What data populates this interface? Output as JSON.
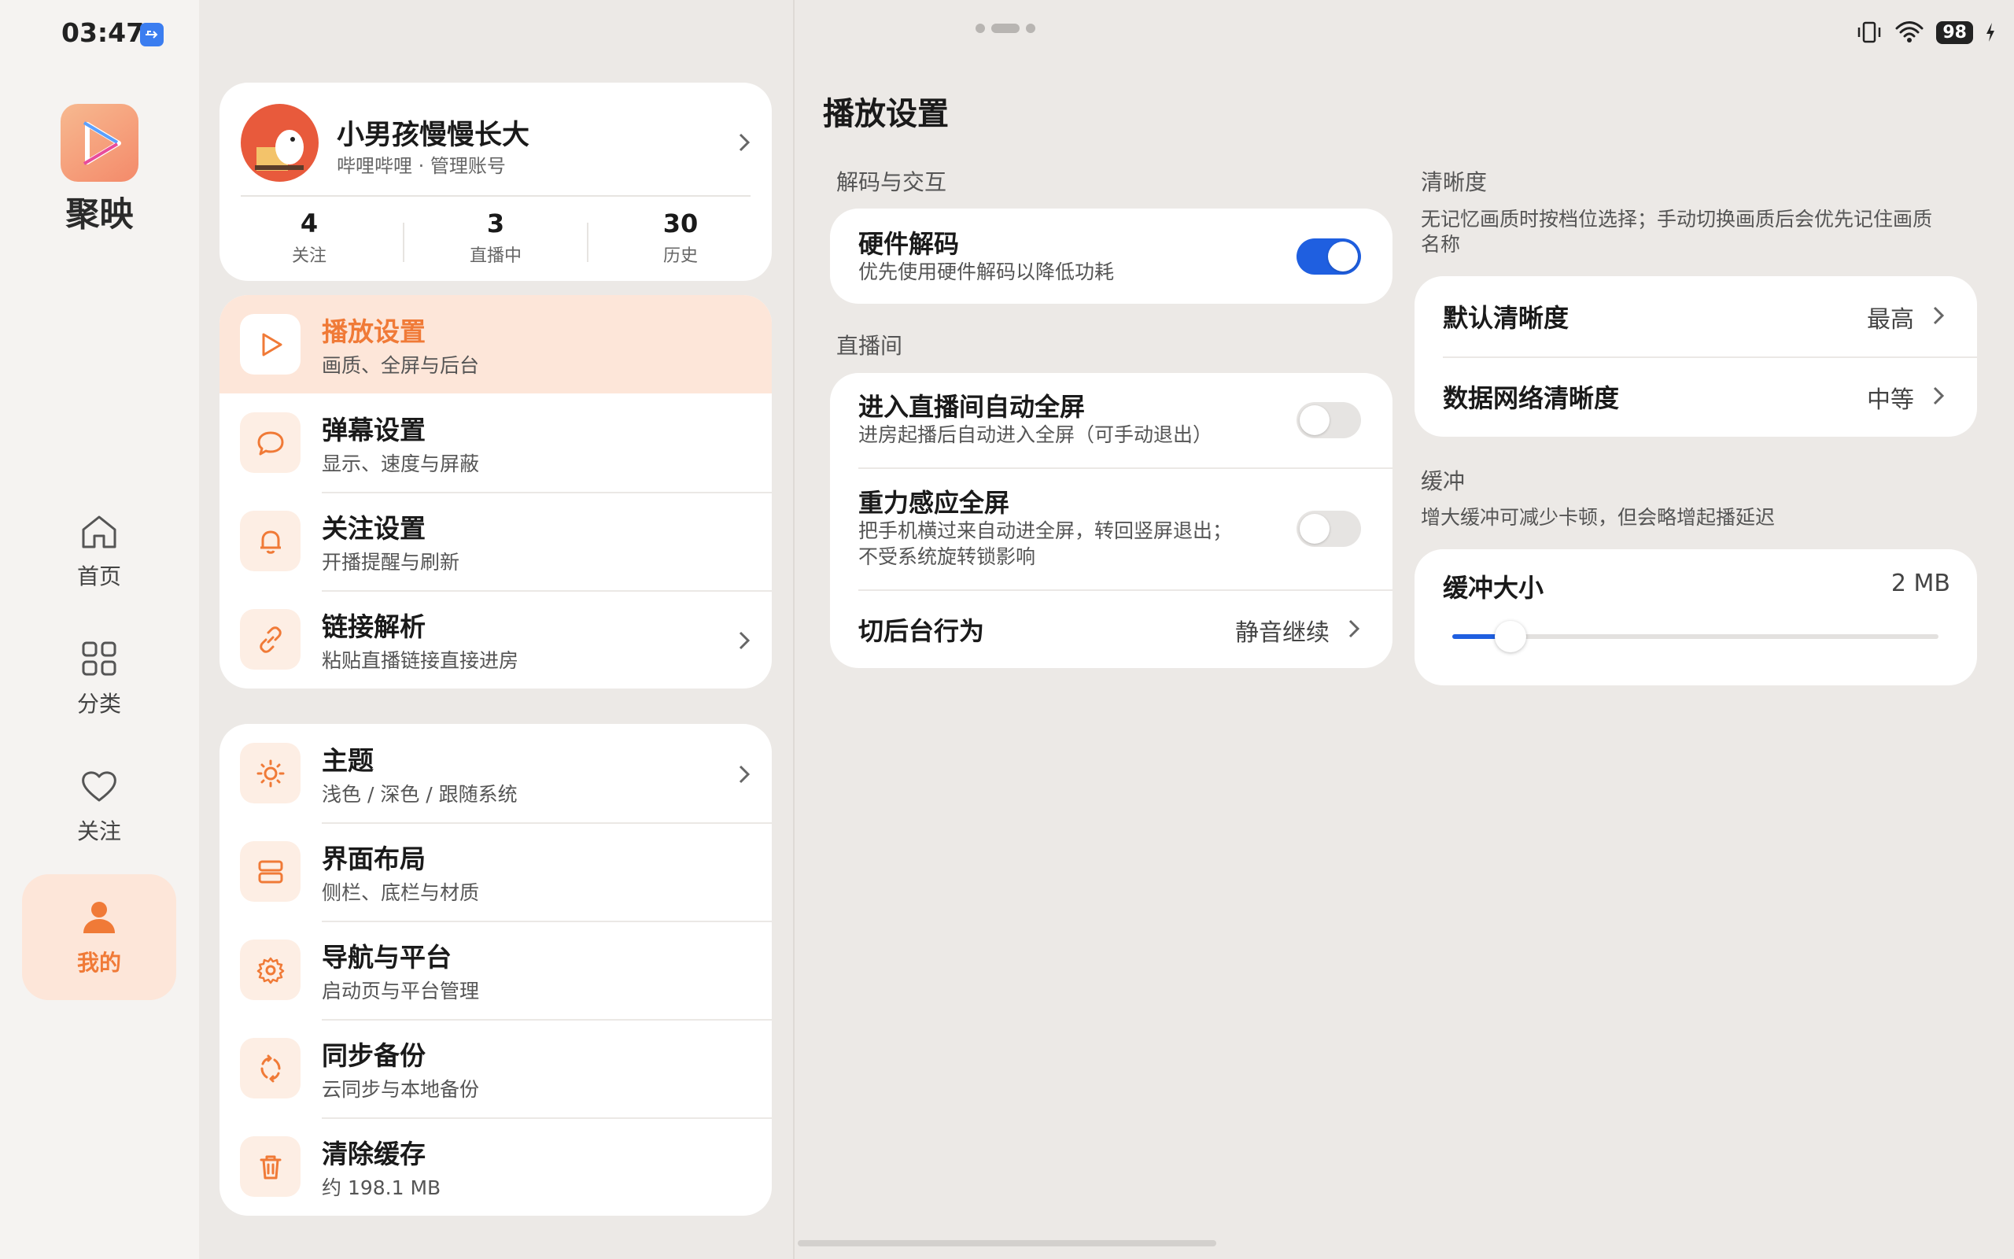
{
  "status_bar": {
    "time": "03:47",
    "battery": "98"
  },
  "app": {
    "name": "聚映"
  },
  "nav": [
    {
      "label": "首页",
      "icon": "home-icon"
    },
    {
      "label": "分类",
      "icon": "grid-icon"
    },
    {
      "label": "关注",
      "icon": "heart-icon"
    },
    {
      "label": "我的",
      "icon": "person-icon",
      "active": true
    }
  ],
  "profile": {
    "name": "小男孩慢慢长大",
    "subtitle": "哔哩哔哩 · 管理账号",
    "stats": [
      {
        "num": "4",
        "label": "关注"
      },
      {
        "num": "3",
        "label": "直播中"
      },
      {
        "num": "30",
        "label": "历史"
      }
    ]
  },
  "menu_group1": [
    {
      "title": "播放设置",
      "sub": "画质、全屏与后台",
      "icon": "play-icon",
      "active": true
    },
    {
      "title": "弹幕设置",
      "sub": "显示、速度与屏蔽",
      "icon": "chat-bubble-icon"
    },
    {
      "title": "关注设置",
      "sub": "开播提醒与刷新",
      "icon": "bell-icon"
    },
    {
      "title": "链接解析",
      "sub": "粘贴直播链接直接进房",
      "icon": "link-icon",
      "chevron": true
    }
  ],
  "menu_group2": [
    {
      "title": "主题",
      "sub": "浅色 / 深色 / 跟随系统",
      "icon": "sun-icon",
      "chevron": true
    },
    {
      "title": "界面布局",
      "sub": "侧栏、底栏与材质",
      "icon": "layout-icon"
    },
    {
      "title": "导航与平台",
      "sub": "启动页与平台管理",
      "icon": "gear-icon"
    },
    {
      "title": "同步备份",
      "sub": "云同步与本地备份",
      "icon": "sync-icon"
    },
    {
      "title": "清除缓存",
      "sub": "约 198.1 MB",
      "icon": "trash-icon"
    }
  ],
  "detail": {
    "title": "播放设置",
    "decode_section": "解码与交互",
    "hw_decode": {
      "title": "硬件解码",
      "sub": "优先使用硬件解码以降低功耗",
      "on": true
    },
    "live_section": "直播间",
    "auto_full": {
      "title": "进入直播间自动全屏",
      "sub": "进房起播后自动进入全屏（可手动退出）",
      "on": false
    },
    "gravity_full": {
      "title": "重力感应全屏",
      "sub1": "把手机横过来自动进全屏，转回竖屏退出；",
      "sub2": "不受系统旋转锁影响",
      "on": false
    },
    "background": {
      "title": "切后台行为",
      "value": "静音继续"
    },
    "quality_section": "清晰度",
    "quality_desc1": "无记忆画质时按档位选择；手动切换画质后会优先记住画质",
    "quality_desc2": "名称",
    "default_quality": {
      "title": "默认清晰度",
      "value": "最高"
    },
    "mobile_quality": {
      "title": "数据网络清晰度",
      "value": "中等"
    },
    "buffer_section": "缓冲",
    "buffer_desc": "增大缓冲可减少卡顿，但会略增起播延迟",
    "buffer_size": {
      "title": "缓冲大小",
      "value": "2 MB",
      "level": 0.12
    }
  },
  "colors": {
    "accent": "#f07a37",
    "toggle_on": "#1f5fe0"
  }
}
